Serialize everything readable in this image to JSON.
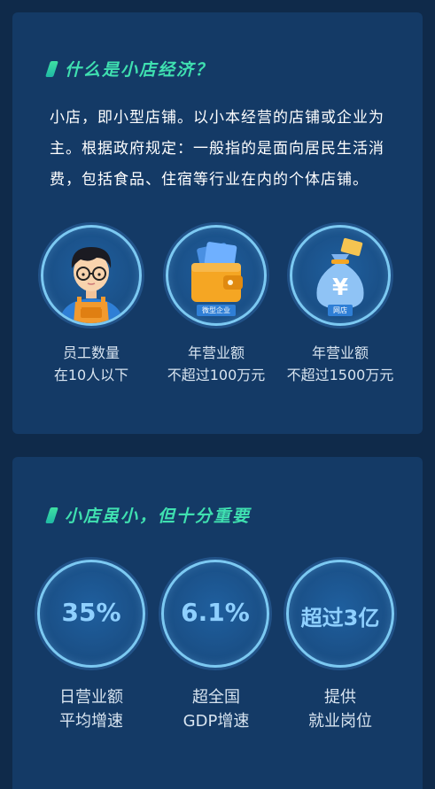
{
  "section1": {
    "title": "什么是小店经济？",
    "intro": "小店，即小型店铺。以小本经营的店铺或企业为主。根据政府规定：一般指的是面向居民生活消费，包括食品、住宿等行业在内的个体店铺。",
    "items": [
      {
        "icon": "worker-icon",
        "line1": "员工数量",
        "line2": "在10人以下"
      },
      {
        "icon": "wallet-icon",
        "badge": "微型企业",
        "line1": "年营业额",
        "line2": "不超过100万元"
      },
      {
        "icon": "money-bag-icon",
        "badge": "网店",
        "line1": "年营业额",
        "line2": "不超过1500万元"
      }
    ]
  },
  "section2": {
    "title": "小店虽小，但十分重要",
    "stats": [
      {
        "value": "35%",
        "line1": "日营业额",
        "line2": "平均增速"
      },
      {
        "value": "6.1%",
        "line1": "超全国",
        "line2": "GDP增速"
      },
      {
        "value": "超过3亿",
        "line1": "提供",
        "line2": "就业岗位"
      }
    ]
  },
  "colors": {
    "background": "#0f2a4a",
    "card": "#143a66",
    "accent_green": "#3fe0b0",
    "circle_ring": "#7cc9f2",
    "stat_value": "#8fd0ff"
  }
}
